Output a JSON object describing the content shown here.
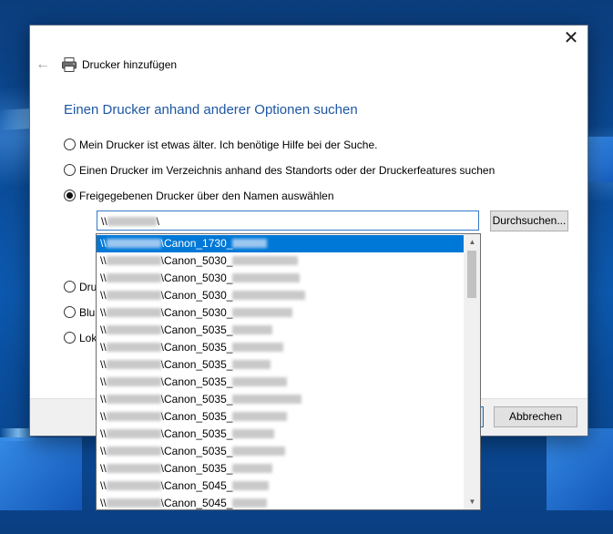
{
  "dialog": {
    "title": "Drucker hinzufügen",
    "heading": "Einen Drucker anhand anderer Optionen suchen",
    "options": [
      {
        "label": "Mein Drucker ist etwas älter. Ich benötige Hilfe bei der Suche.",
        "checked": false
      },
      {
        "label": "Einen Drucker im Verzeichnis anhand des Standorts oder der Druckerfeatures suchen",
        "checked": false
      },
      {
        "label": "Freigegebenen Drucker über den Namen auswählen",
        "checked": true
      },
      {
        "label": "Dru",
        "checked": false
      },
      {
        "label": "Blu",
        "checked": false
      },
      {
        "label": "Lok",
        "checked": false
      }
    ],
    "name_input": {
      "prefix": "\\\\",
      "suffix": "\\"
    },
    "browse_label": "Durchsuchen...",
    "cancel_label": "Abbrechen"
  },
  "dropdown": {
    "items": [
      {
        "prefix": "\\\\",
        "printer": "\\Canon_1730_",
        "selected": true
      },
      {
        "prefix": "\\\\",
        "printer": "\\Canon_5030_",
        "selected": false
      },
      {
        "prefix": "\\\\",
        "printer": "\\Canon_5030_",
        "selected": false
      },
      {
        "prefix": "\\\\",
        "printer": "\\Canon_5030_",
        "selected": false
      },
      {
        "prefix": "\\\\",
        "printer": "\\Canon_5030_",
        "selected": false
      },
      {
        "prefix": "\\\\",
        "printer": "\\Canon_5035_",
        "selected": false
      },
      {
        "prefix": "\\\\",
        "printer": "\\Canon_5035_",
        "selected": false
      },
      {
        "prefix": "\\\\",
        "printer": "\\Canon_5035_",
        "selected": false
      },
      {
        "prefix": "\\\\",
        "printer": "\\Canon_5035_",
        "selected": false
      },
      {
        "prefix": "\\\\",
        "printer": "\\Canon_5035_",
        "selected": false
      },
      {
        "prefix": "\\\\",
        "printer": "\\Canon_5035_",
        "selected": false
      },
      {
        "prefix": "\\\\",
        "printer": "\\Canon_5035_",
        "selected": false
      },
      {
        "prefix": "\\\\",
        "printer": "\\Canon_5035_",
        "selected": false
      },
      {
        "prefix": "\\\\",
        "printer": "\\Canon_5035_",
        "selected": false
      },
      {
        "prefix": "\\\\",
        "printer": "\\Canon_5045_",
        "selected": false
      },
      {
        "prefix": "\\\\",
        "printer": "\\Canon_5045_",
        "selected": false
      }
    ]
  },
  "icons": {
    "close": "close-icon",
    "back": "back-arrow-icon",
    "printer": "printer-icon",
    "scroll_up": "scroll-up-icon",
    "scroll_down": "scroll-down-icon"
  }
}
